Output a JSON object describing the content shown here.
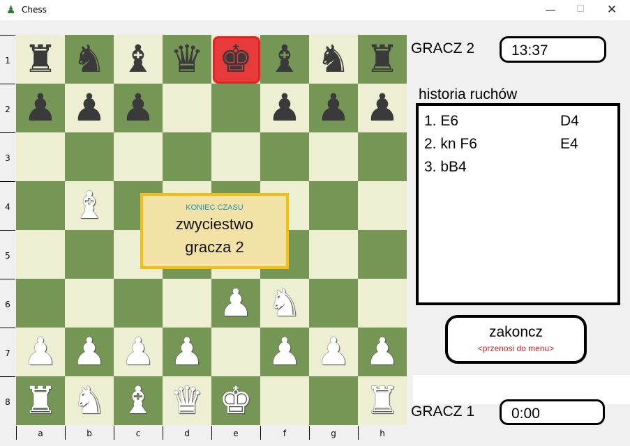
{
  "window": {
    "title": "Chess",
    "app_icon": "pawn-icon",
    "minimize": "—",
    "maximize": "☐",
    "close": "✕"
  },
  "board": {
    "ranks": [
      "1",
      "2",
      "3",
      "4",
      "5",
      "6",
      "7",
      "8"
    ],
    "files": [
      "a",
      "b",
      "c",
      "d",
      "e",
      "f",
      "g",
      "h"
    ],
    "colors": {
      "light": "#eeeed2",
      "dark": "#769656",
      "highlight": "#e32222"
    },
    "highlighted_square": "e1",
    "pieces": [
      {
        "square": "a1",
        "color": "black",
        "type": "rook",
        "glyph": "♜"
      },
      {
        "square": "b1",
        "color": "black",
        "type": "knight",
        "glyph": "♞"
      },
      {
        "square": "c1",
        "color": "black",
        "type": "bishop",
        "glyph": "♝"
      },
      {
        "square": "d1",
        "color": "black",
        "type": "queen",
        "glyph": "♛"
      },
      {
        "square": "e1",
        "color": "black",
        "type": "king",
        "glyph": "♚"
      },
      {
        "square": "f1",
        "color": "black",
        "type": "bishop",
        "glyph": "♝"
      },
      {
        "square": "g1",
        "color": "black",
        "type": "knight",
        "glyph": "♞"
      },
      {
        "square": "h1",
        "color": "black",
        "type": "rook",
        "glyph": "♜"
      },
      {
        "square": "a2",
        "color": "black",
        "type": "pawn",
        "glyph": "♟"
      },
      {
        "square": "b2",
        "color": "black",
        "type": "pawn",
        "glyph": "♟"
      },
      {
        "square": "c2",
        "color": "black",
        "type": "pawn",
        "glyph": "♟"
      },
      {
        "square": "f2",
        "color": "black",
        "type": "pawn",
        "glyph": "♟"
      },
      {
        "square": "g2",
        "color": "black",
        "type": "pawn",
        "glyph": "♟"
      },
      {
        "square": "h2",
        "color": "black",
        "type": "pawn",
        "glyph": "♟"
      },
      {
        "square": "b4",
        "color": "white",
        "type": "bishop",
        "glyph": "♝"
      },
      {
        "square": "e6",
        "color": "white",
        "type": "pawn",
        "glyph": "♟"
      },
      {
        "square": "f6",
        "color": "white",
        "type": "knight",
        "glyph": "♞"
      },
      {
        "square": "a7",
        "color": "white",
        "type": "pawn",
        "glyph": "♟"
      },
      {
        "square": "b7",
        "color": "white",
        "type": "pawn",
        "glyph": "♟"
      },
      {
        "square": "c7",
        "color": "white",
        "type": "pawn",
        "glyph": "♟"
      },
      {
        "square": "d7",
        "color": "white",
        "type": "pawn",
        "glyph": "♟"
      },
      {
        "square": "f7",
        "color": "white",
        "type": "pawn",
        "glyph": "♟"
      },
      {
        "square": "g7",
        "color": "white",
        "type": "pawn",
        "glyph": "♟"
      },
      {
        "square": "h7",
        "color": "white",
        "type": "pawn",
        "glyph": "♟"
      },
      {
        "square": "a8",
        "color": "white",
        "type": "rook",
        "glyph": "♜"
      },
      {
        "square": "b8",
        "color": "white",
        "type": "knight",
        "glyph": "♞"
      },
      {
        "square": "c8",
        "color": "white",
        "type": "bishop",
        "glyph": "♝"
      },
      {
        "square": "d8",
        "color": "white",
        "type": "queen",
        "glyph": "♛"
      },
      {
        "square": "e8",
        "color": "white",
        "type": "king",
        "glyph": "♚"
      },
      {
        "square": "h8",
        "color": "white",
        "type": "rook",
        "glyph": "♜"
      }
    ]
  },
  "overlay": {
    "subtitle": "KONIEC CZASU",
    "line1": "zwyciestwo",
    "line2": "gracza 2",
    "border_color": "#f0bf18"
  },
  "player2": {
    "label": "GRACZ 2",
    "time": "13:37"
  },
  "player1": {
    "label": "GRACZ 1",
    "time": "0:00"
  },
  "history": {
    "title": "historia ruchów",
    "moves": [
      {
        "white": "1. E6",
        "black": "D4"
      },
      {
        "white": "2. kn F6",
        "black": "E4"
      },
      {
        "white": "3. bB4",
        "black": ""
      }
    ]
  },
  "end_button": {
    "label": "zakoncz",
    "sublabel": "<przenosi do menu>",
    "sublabel_color": "#d21e1e"
  }
}
